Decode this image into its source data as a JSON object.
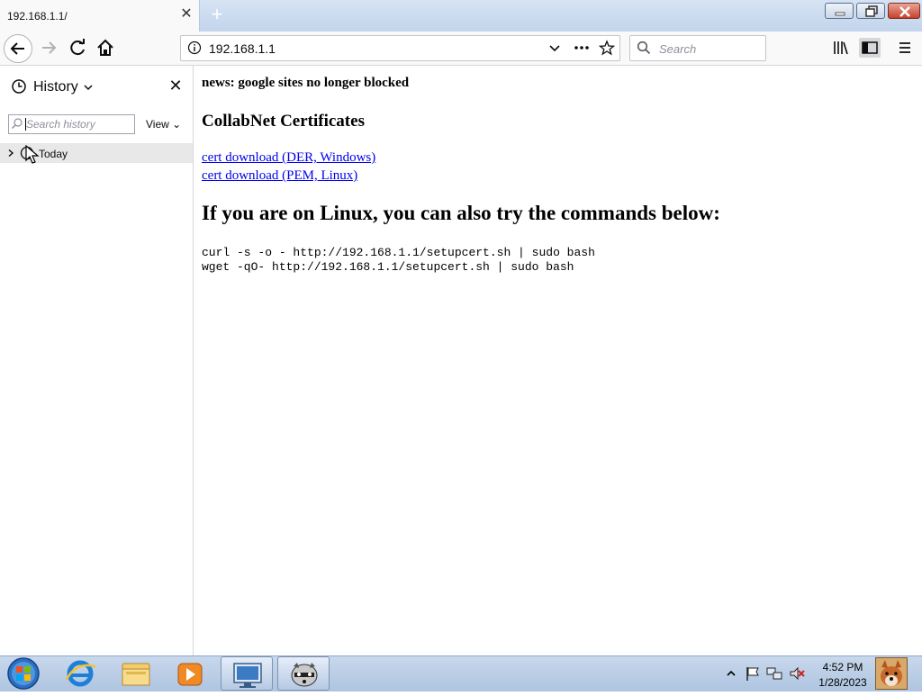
{
  "browser": {
    "tab_title": "192.168.1.1/",
    "url": "192.168.1.1",
    "search_placeholder": "Search"
  },
  "sidebar": {
    "title": "History",
    "search_placeholder": "Search history",
    "view_label": "View",
    "groups": [
      {
        "label": "Today"
      }
    ]
  },
  "page": {
    "news": "news: google sites no longer blocked",
    "certs_heading": "CollabNet Certificates",
    "links": [
      {
        "label": "cert download (DER, Windows)"
      },
      {
        "label": "cert download (PEM, Linux)"
      }
    ],
    "linux_heading": "If you are on Linux, you can also try the commands below:",
    "commands": [
      "curl -s -o - http://192.168.1.1/setupcert.sh | sudo bash",
      "wget -qO- http://192.168.1.1/setupcert.sh | sudo bash"
    ]
  },
  "taskbar": {
    "time": "4:52 PM",
    "date": "1/28/2023"
  },
  "colors": {
    "link": "#0000ee",
    "taskbar": "#b6cbe6",
    "sidebar_row": "#e8e8e8"
  }
}
